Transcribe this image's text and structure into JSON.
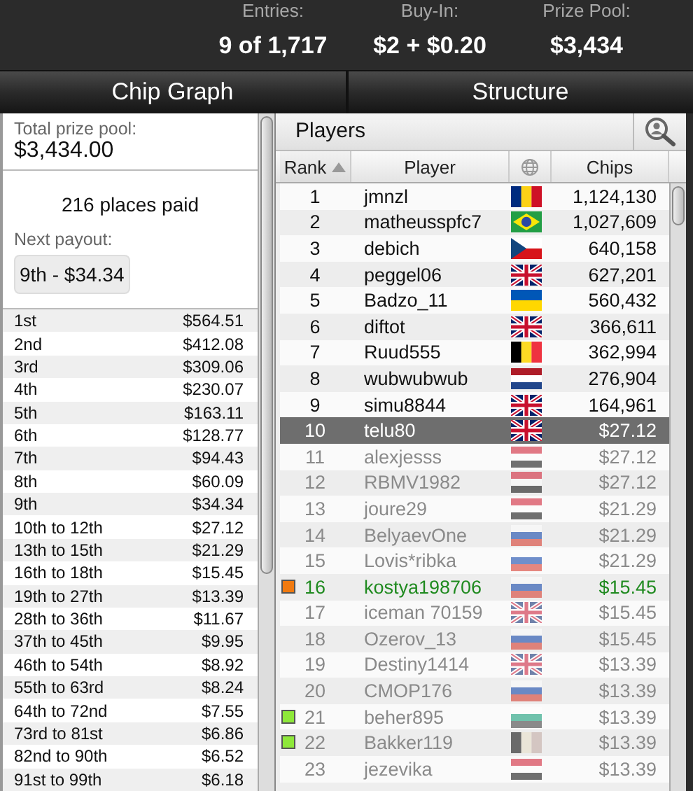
{
  "stats": [
    {
      "label": "Entries:",
      "value": "9 of 1,717"
    },
    {
      "label": "Buy-In:",
      "value": "$2 + $0.20"
    },
    {
      "label": "Prize Pool:",
      "value": "$3,434"
    }
  ],
  "tabs": [
    {
      "label": "Chip Graph",
      "selected": false
    },
    {
      "label": "Structure",
      "selected": false
    }
  ],
  "prize_panel": {
    "total_label": "Total prize pool:",
    "total_value": "$3,434.00",
    "places_paid": "216 places paid",
    "next_payout_label": "Next payout:",
    "next_payout": "9th - $34.34",
    "payouts": [
      {
        "place": "1st",
        "amount": "$564.51"
      },
      {
        "place": "2nd",
        "amount": "$412.08"
      },
      {
        "place": "3rd",
        "amount": "$309.06"
      },
      {
        "place": "4th",
        "amount": "$230.07"
      },
      {
        "place": "5th",
        "amount": "$163.11"
      },
      {
        "place": "6th",
        "amount": "$128.77"
      },
      {
        "place": "7th",
        "amount": "$94.43"
      },
      {
        "place": "8th",
        "amount": "$60.09"
      },
      {
        "place": "9th",
        "amount": "$34.34"
      },
      {
        "place": "10th to 12th",
        "amount": "$27.12"
      },
      {
        "place": "13th to 15th",
        "amount": "$21.29"
      },
      {
        "place": "16th to 18th",
        "amount": "$15.45"
      },
      {
        "place": "19th to 27th",
        "amount": "$13.39"
      },
      {
        "place": "28th to 36th",
        "amount": "$11.67"
      },
      {
        "place": "37th to 45th",
        "amount": "$9.95"
      },
      {
        "place": "46th to 54th",
        "amount": "$8.92"
      },
      {
        "place": "55th to 63rd",
        "amount": "$8.24"
      },
      {
        "place": "64th to 72nd",
        "amount": "$7.55"
      },
      {
        "place": "73rd to 81st",
        "amount": "$6.86"
      },
      {
        "place": "82nd to 90th",
        "amount": "$6.52"
      },
      {
        "place": "91st to 99th",
        "amount": "$6.18"
      }
    ]
  },
  "players_panel": {
    "title": "Players",
    "columns": [
      {
        "label": "Rank",
        "sorted": true
      },
      {
        "label": "Player",
        "sorted": false
      },
      {
        "kind": "globe",
        "sorted": false
      },
      {
        "label": "Chips",
        "sorted": false
      }
    ],
    "rows": [
      {
        "rank": "1",
        "player": "jmnzl",
        "chips": "1,124,130",
        "selected": false,
        "eliminated": false,
        "highlighted": false
      },
      {
        "rank": "2",
        "player": "matheusspfc7",
        "chips": "1,027,609",
        "selected": false,
        "eliminated": false,
        "highlighted": false
      },
      {
        "rank": "3",
        "player": "debich",
        "chips": "640,158",
        "selected": false,
        "eliminated": false,
        "highlighted": false
      },
      {
        "rank": "4",
        "player": "peggel06",
        "chips": "627,201",
        "selected": false,
        "eliminated": false,
        "highlighted": false
      },
      {
        "rank": "5",
        "player": "Badzo_11",
        "chips": "560,432",
        "selected": false,
        "eliminated": false,
        "highlighted": false
      },
      {
        "rank": "6",
        "player": "diftot",
        "chips": "366,611",
        "selected": false,
        "eliminated": false,
        "highlighted": false
      },
      {
        "rank": "7",
        "player": "Ruud555",
        "chips": "362,994",
        "selected": false,
        "eliminated": false,
        "highlighted": false
      },
      {
        "rank": "8",
        "player": "wubwubwub",
        "chips": "276,904",
        "selected": false,
        "eliminated": false,
        "highlighted": false
      },
      {
        "rank": "9",
        "player": "simu8844",
        "chips": "164,961",
        "selected": false,
        "eliminated": false,
        "highlighted": false
      },
      {
        "rank": "10",
        "player": "telu80",
        "chips": "$27.12",
        "selected": true,
        "eliminated": true,
        "highlighted": false
      },
      {
        "rank": "11",
        "player": "alexjesss",
        "chips": "$27.12",
        "selected": false,
        "eliminated": true,
        "highlighted": false
      },
      {
        "rank": "12",
        "player": "RBMV1982",
        "chips": "$27.12",
        "selected": false,
        "eliminated": true,
        "highlighted": false
      },
      {
        "rank": "13",
        "player": "joure29",
        "chips": "$21.29",
        "selected": false,
        "eliminated": true,
        "highlighted": false
      },
      {
        "rank": "14",
        "player": "BelyaevOne",
        "chips": "$21.29",
        "selected": false,
        "eliminated": true,
        "highlighted": false
      },
      {
        "rank": "15",
        "player": "Lovis*ribka",
        "chips": "$21.29",
        "selected": false,
        "eliminated": true,
        "highlighted": false
      },
      {
        "rank": "16",
        "player": "kostya198706",
        "chips": "$15.45",
        "selected": false,
        "eliminated": true,
        "highlighted": true,
        "color": "#f07a10"
      },
      {
        "rank": "17",
        "player": "iceman 70159",
        "chips": "$15.45",
        "selected": false,
        "eliminated": true,
        "highlighted": false
      },
      {
        "rank": "18",
        "player": "Ozerov_13",
        "chips": "$15.45",
        "selected": false,
        "eliminated": true,
        "highlighted": false
      },
      {
        "rank": "19",
        "player": "Destiny1414",
        "chips": "$13.39",
        "selected": false,
        "eliminated": true,
        "highlighted": false
      },
      {
        "rank": "20",
        "player": "CMOP176",
        "chips": "$13.39",
        "selected": false,
        "eliminated": true,
        "highlighted": false
      },
      {
        "rank": "21",
        "player": "beher895",
        "chips": "$13.39",
        "selected": false,
        "eliminated": true,
        "highlighted": false,
        "color": "#8ee83a"
      },
      {
        "rank": "22",
        "player": "Bakker119",
        "chips": "$13.39",
        "selected": false,
        "eliminated": true,
        "highlighted": false,
        "color": "#8ee83a"
      },
      {
        "rank": "23",
        "player": "jezevika",
        "chips": "$13.39",
        "selected": false,
        "eliminated": true,
        "highlighted": false
      }
    ]
  }
}
